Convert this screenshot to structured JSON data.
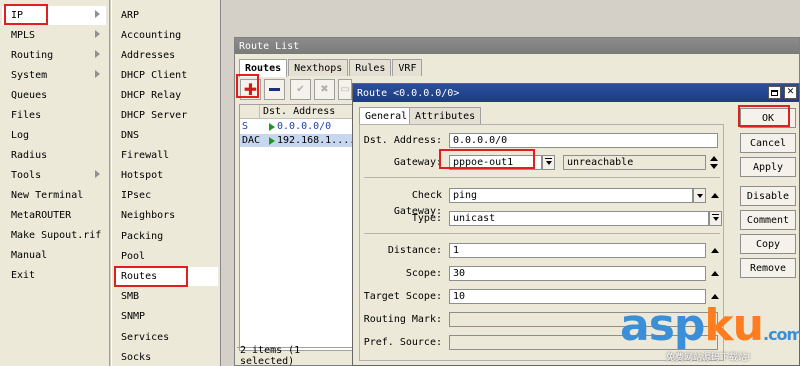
{
  "main_menu": {
    "items": [
      {
        "label": "IP",
        "submenu": true
      },
      {
        "label": "MPLS",
        "submenu": true
      },
      {
        "label": "Routing",
        "submenu": true
      },
      {
        "label": "System",
        "submenu": true
      },
      {
        "label": "Queues",
        "submenu": false
      },
      {
        "label": "Files",
        "submenu": false
      },
      {
        "label": "Log",
        "submenu": false
      },
      {
        "label": "Radius",
        "submenu": false
      },
      {
        "label": "Tools",
        "submenu": true
      },
      {
        "label": "New Terminal",
        "submenu": false
      },
      {
        "label": "MetaROUTER",
        "submenu": false
      },
      {
        "label": "Make Supout.rif",
        "submenu": false
      },
      {
        "label": "Manual",
        "submenu": false
      },
      {
        "label": "Exit",
        "submenu": false
      }
    ]
  },
  "ip_submenu": {
    "items": [
      "ARP",
      "Accounting",
      "Addresses",
      "DHCP Client",
      "DHCP Relay",
      "DHCP Server",
      "DNS",
      "Firewall",
      "Hotspot",
      "IPsec",
      "Neighbors",
      "Packing",
      "Pool",
      "Routes",
      "SMB",
      "SNMP",
      "Services",
      "Socks"
    ]
  },
  "route_list": {
    "title": "Route List",
    "tabs": [
      "Routes",
      "Nexthops",
      "Rules",
      "VRF"
    ],
    "columns": [
      "",
      "Dst. Address"
    ],
    "rows": [
      {
        "flag": "S",
        "dst": "0.0.0.0/0"
      },
      {
        "flag": "DAC",
        "dst": "192.168.1...."
      }
    ],
    "status": "2 items (1 selected)"
  },
  "route_dialog": {
    "title": "Route <0.0.0.0/0>",
    "tabs": [
      "General",
      "Attributes"
    ],
    "fields": {
      "dst_address": {
        "label": "Dst. Address:",
        "value": "0.0.0.0/0"
      },
      "gateway": {
        "label": "Gateway:",
        "value": "pppoe-out1",
        "status": "unreachable"
      },
      "check_gateway": {
        "label": "Check Gateway:",
        "value": "ping"
      },
      "type": {
        "label": "Type:",
        "value": "unicast"
      },
      "distance": {
        "label": "Distance:",
        "value": "1"
      },
      "scope": {
        "label": "Scope:",
        "value": "30"
      },
      "target_scope": {
        "label": "Target Scope:",
        "value": "10"
      },
      "routing_mark": {
        "label": "Routing Mark:",
        "value": ""
      },
      "pref_source": {
        "label": "Pref. Source:",
        "value": ""
      }
    },
    "buttons": [
      "OK",
      "Cancel",
      "Apply",
      "Disable",
      "Comment",
      "Copy",
      "Remove"
    ]
  },
  "watermark": {
    "text": "aspku.com",
    "sub": "免费网站源码下载站!"
  },
  "colors": {
    "highlight_red": "#e02020",
    "title_blue": "#1c3d84",
    "green_flag": "#1a9a1a",
    "selection": "#c6d7ef"
  }
}
